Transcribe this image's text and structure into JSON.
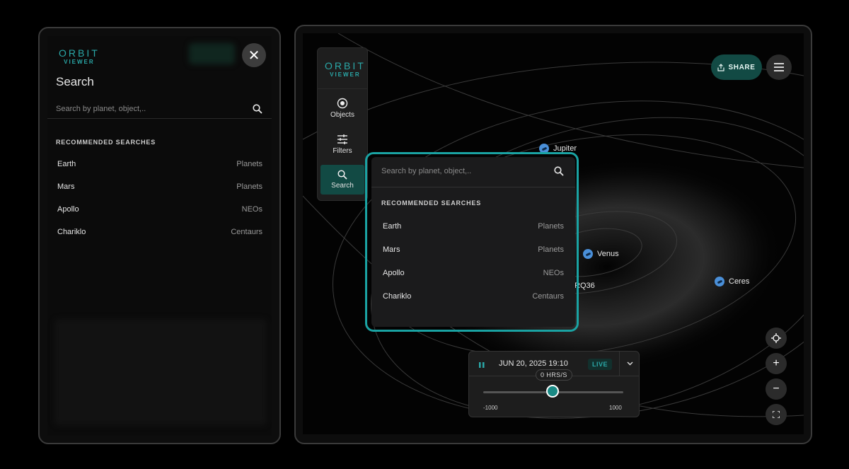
{
  "logo": {
    "line1": "ORBIT",
    "line2": "VIEWER"
  },
  "mobile": {
    "close_icon": "close-icon",
    "title": "Search",
    "search_placeholder": "Search by planet, object,..",
    "section_title": "RECOMMENDED SEARCHES",
    "recommended": [
      {
        "name": "Earth",
        "category": "Planets"
      },
      {
        "name": "Mars",
        "category": "Planets"
      },
      {
        "name": "Apollo",
        "category": "NEOs"
      },
      {
        "name": "Chariklo",
        "category": "Centaurs"
      }
    ]
  },
  "desktop": {
    "nav": [
      {
        "label": "Objects",
        "icon": "objects-icon"
      },
      {
        "label": "Filters",
        "icon": "sliders-icon"
      },
      {
        "label": "Search",
        "icon": "search-icon"
      }
    ],
    "share_label": "SHARE",
    "planets": [
      {
        "name": "Jupiter"
      },
      {
        "name": "Venus"
      },
      {
        "name": "Ceres"
      }
    ],
    "partial_label": "RQ36",
    "search": {
      "placeholder": "Search by planet, object,..",
      "section_title": "RECOMMENDED SEARCHES",
      "recommended": [
        {
          "name": "Earth",
          "category": "Planets"
        },
        {
          "name": "Mars",
          "category": "Planets"
        },
        {
          "name": "Apollo",
          "category": "NEOs"
        },
        {
          "name": "Chariklo",
          "category": "Centaurs"
        }
      ]
    },
    "time": {
      "datetime": "JUN 20, 2025 19:10",
      "live": "LIVE",
      "rate": "0 HRS/S",
      "min": "-1000",
      "max": "1000",
      "rate_value": 0
    },
    "zoom_in": "+",
    "zoom_out": "−"
  },
  "colors": {
    "accent": "#2aa8a8",
    "planet": "#4a8fd8",
    "highlight": "#1aa3a3"
  }
}
